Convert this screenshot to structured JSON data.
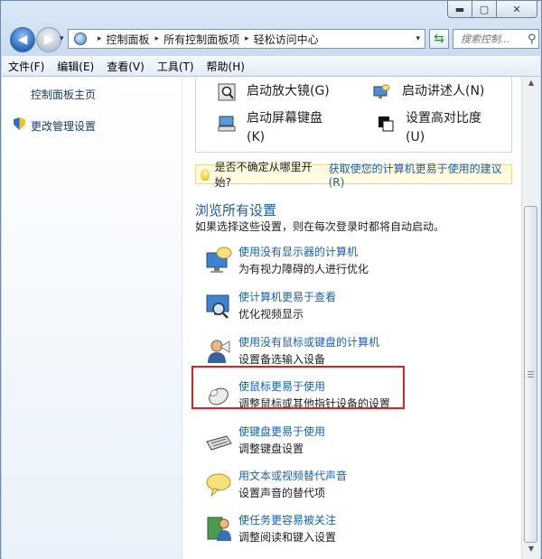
{
  "window": {
    "caption_minimize": "▬",
    "caption_maximize": "▢",
    "caption_close": "✕"
  },
  "navbar": {
    "back_glyph": "◀",
    "forward_glyph": "▶",
    "recent_glyph": "▾",
    "breadcrumbs": [
      "控制面板",
      "所有控制面板项",
      "轻松访问中心"
    ],
    "separator": "▸",
    "dropdown_glyph": "▾",
    "refresh_glyph": "⇆",
    "search_placeholder": "搜索控制...",
    "search_icon_glyph": "⚲"
  },
  "menubar": {
    "items": [
      "文件(F)",
      "编辑(E)",
      "查看(V)",
      "工具(T)",
      "帮助(H)"
    ]
  },
  "sidebar": {
    "home_link": "控制面板主页",
    "change_admin_link": "更改管理设置"
  },
  "quick_access": {
    "items": [
      {
        "label": "启动放大镜(G)",
        "icon": "magnifier-icon"
      },
      {
        "label": "启动讲述人(N)",
        "icon": "narrator-icon"
      },
      {
        "label_line1": "启动屏幕键盘",
        "label_line2": "(K)",
        "icon": "onscreen-keyboard-icon"
      },
      {
        "label_line1": "设置高对比度",
        "label_line2": "(U)",
        "icon": "high-contrast-icon"
      }
    ]
  },
  "infobar": {
    "question": "是否不确定从哪里开始?",
    "link": "获取使您的计算机更易于使用的建议(R)"
  },
  "browse": {
    "title": "浏览所有设置",
    "description": "如果选择这些设置，则在每次登录时都将自动启动。"
  },
  "settings": [
    {
      "title": "使用没有显示器的计算机",
      "desc": "为有视力障碍的人进行优化",
      "icon": "monitor-speech-icon"
    },
    {
      "title": "使计算机更易于查看",
      "desc": "优化视频显示",
      "icon": "magnified-monitor-icon"
    },
    {
      "title": "使用没有鼠标或键盘的计算机",
      "desc": "设置备选输入设备",
      "icon": "person-speech-icon"
    },
    {
      "title": "使鼠标更易于使用",
      "desc": "调整鼠标或其他指针设备的设置",
      "icon": "mouse-icon"
    },
    {
      "title": "使键盘更易于使用",
      "desc": "调整键盘设置",
      "icon": "keyboard-icon"
    },
    {
      "title": "用文本或视频替代声音",
      "desc": "设置声音的替代项",
      "icon": "speech-bubble-icon"
    },
    {
      "title": "使任务更容易被关注",
      "desc": "调整阅读和键入设置",
      "icon": "reading-person-icon"
    }
  ],
  "colors": {
    "link": "#1560bd",
    "heading": "#1e5aa6",
    "highlight_box": "#e02020",
    "info_bg": "#fffbe0"
  },
  "scrollbar": {
    "up_glyph": "▲",
    "down_glyph": "▼"
  }
}
